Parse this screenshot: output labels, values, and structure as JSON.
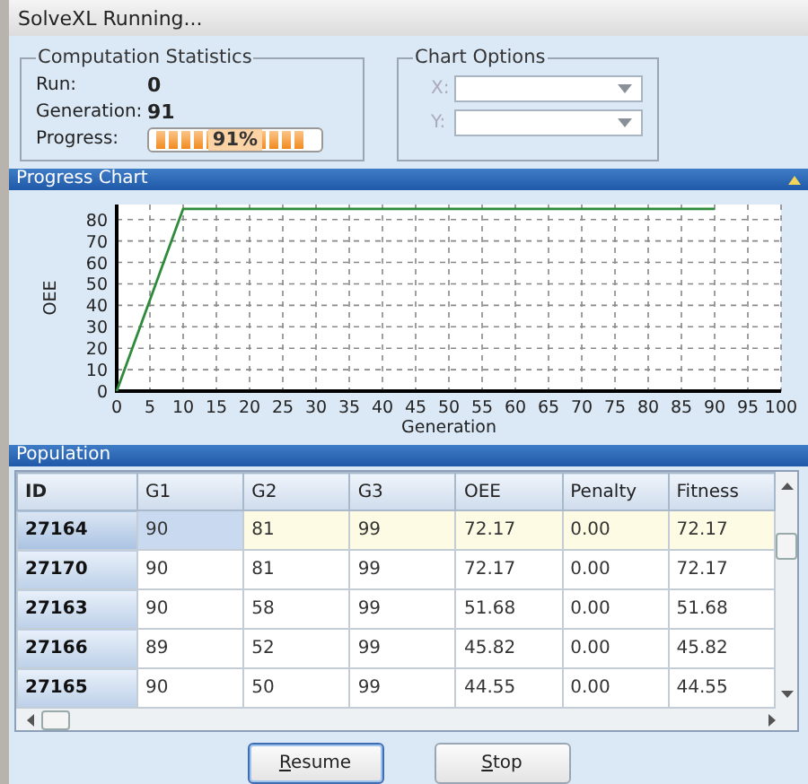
{
  "window": {
    "title": "SolveXL Running..."
  },
  "computation_statistics": {
    "title": "Computation Statistics",
    "fields": [
      {
        "label": "Run:",
        "value": "0"
      },
      {
        "label": "Generation:",
        "value": "91"
      }
    ],
    "progress": {
      "label": "Progress:",
      "level": 0.91,
      "reading": "91%"
    }
  },
  "chart_options": {
    "title": "Chart Options",
    "dropdowns": [
      {
        "label": "X:",
        "disabled": true
      },
      {
        "label": "Y:",
        "disabled": true
      }
    ]
  },
  "progress_chart": {
    "title": "Progress Chart",
    "chart_data": {
      "type": "line",
      "xlabel": "Generation",
      "ylabel": "OEE",
      "x": [
        0,
        10,
        90
      ],
      "grid": true,
      "series": [
        {
          "color": "#2e8b3a",
          "values": [
            0,
            85,
            85
          ]
        }
      ],
      "xlim": [
        0,
        100
      ],
      "ylim": [
        0,
        87
      ],
      "xticks": [
        0,
        5,
        10,
        15,
        20,
        25,
        30,
        35,
        40,
        45,
        50,
        55,
        60,
        65,
        70,
        75,
        80,
        85,
        90,
        95,
        100
      ],
      "yticks": [
        0,
        10,
        20,
        30,
        40,
        50,
        60,
        70,
        80
      ]
    }
  },
  "population": {
    "title": "Population",
    "columns": [
      "ID",
      "G1",
      "G2",
      "G3",
      "OEE",
      "Penalty",
      "Fitness"
    ],
    "rows": [
      {
        "selected": true,
        "cells": [
          "27164",
          "90",
          "81",
          "99",
          "72.17",
          "0.00",
          "72.17"
        ]
      },
      {
        "selected": false,
        "cells": [
          "27170",
          "90",
          "81",
          "99",
          "72.17",
          "0.00",
          "72.17"
        ]
      },
      {
        "selected": false,
        "cells": [
          "27163",
          "90",
          "58",
          "99",
          "51.68",
          "0.00",
          "51.68"
        ]
      },
      {
        "selected": false,
        "cells": [
          "27166",
          "89",
          "52",
          "99",
          "45.82",
          "0.00",
          "45.82"
        ]
      },
      {
        "selected": false,
        "cells": [
          "27165",
          "90",
          "50",
          "99",
          "44.55",
          "0.00",
          "44.55"
        ]
      }
    ]
  },
  "buttons": [
    {
      "label": "Resume",
      "focused": true
    },
    {
      "label": "Stop",
      "focused": false
    }
  ]
}
